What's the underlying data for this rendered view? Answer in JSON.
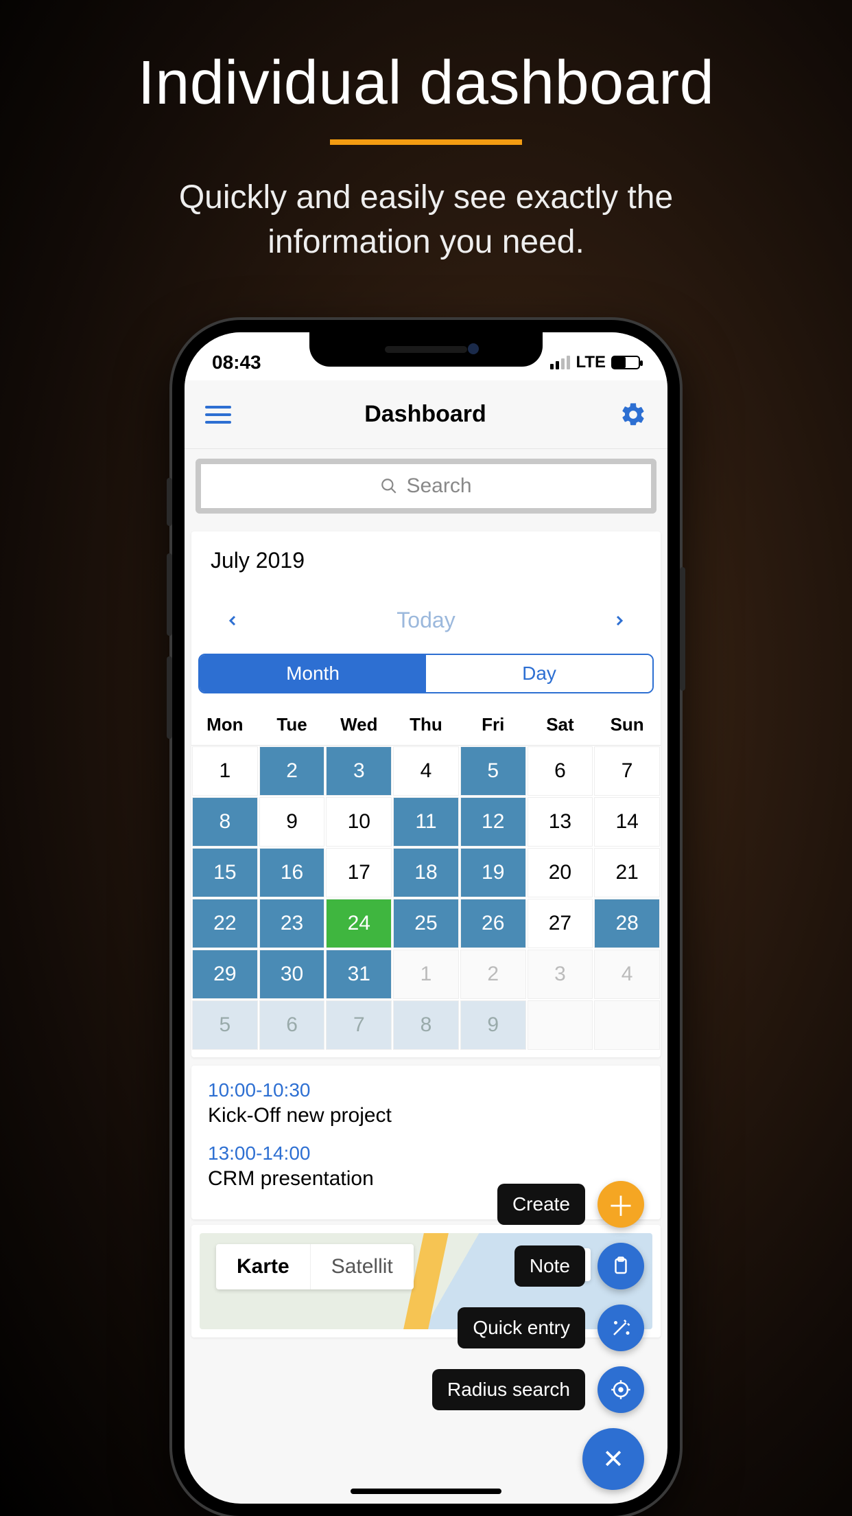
{
  "promo": {
    "title": "Individual dashboard",
    "subtitle_line1": "Quickly and easily see exactly the",
    "subtitle_line2": "information you need."
  },
  "status": {
    "time": "08:43",
    "carrier": "LTE"
  },
  "nav": {
    "title": "Dashboard"
  },
  "search": {
    "placeholder": "Search"
  },
  "calendar": {
    "month_label": "July 2019",
    "today_label": "Today",
    "tabs": {
      "month": "Month",
      "day": "Day"
    },
    "weekdays": [
      "Mon",
      "Tue",
      "Wed",
      "Thu",
      "Fri",
      "Sat",
      "Sun"
    ],
    "rows": [
      [
        {
          "d": "1",
          "s": "plain"
        },
        {
          "d": "2",
          "s": "mark"
        },
        {
          "d": "3",
          "s": "mark"
        },
        {
          "d": "4",
          "s": "plain"
        },
        {
          "d": "5",
          "s": "mark"
        },
        {
          "d": "6",
          "s": "plain"
        },
        {
          "d": "7",
          "s": "plain"
        }
      ],
      [
        {
          "d": "8",
          "s": "mark"
        },
        {
          "d": "9",
          "s": "plain"
        },
        {
          "d": "10",
          "s": "plain"
        },
        {
          "d": "11",
          "s": "mark"
        },
        {
          "d": "12",
          "s": "mark"
        },
        {
          "d": "13",
          "s": "plain"
        },
        {
          "d": "14",
          "s": "plain"
        }
      ],
      [
        {
          "d": "15",
          "s": "mark"
        },
        {
          "d": "16",
          "s": "mark"
        },
        {
          "d": "17",
          "s": "plain"
        },
        {
          "d": "18",
          "s": "mark"
        },
        {
          "d": "19",
          "s": "mark"
        },
        {
          "d": "20",
          "s": "plain"
        },
        {
          "d": "21",
          "s": "plain"
        }
      ],
      [
        {
          "d": "22",
          "s": "mark"
        },
        {
          "d": "23",
          "s": "mark"
        },
        {
          "d": "24",
          "s": "today"
        },
        {
          "d": "25",
          "s": "mark"
        },
        {
          "d": "26",
          "s": "mark"
        },
        {
          "d": "27",
          "s": "plain"
        },
        {
          "d": "28",
          "s": "mark"
        }
      ],
      [
        {
          "d": "29",
          "s": "mark"
        },
        {
          "d": "30",
          "s": "mark"
        },
        {
          "d": "31",
          "s": "mark"
        },
        {
          "d": "1",
          "s": "out"
        },
        {
          "d": "2",
          "s": "out"
        },
        {
          "d": "3",
          "s": "out"
        },
        {
          "d": "4",
          "s": "out"
        }
      ],
      [
        {
          "d": "5",
          "s": "outmark"
        },
        {
          "d": "6",
          "s": "outmark"
        },
        {
          "d": "7",
          "s": "outmark"
        },
        {
          "d": "8",
          "s": "outmark"
        },
        {
          "d": "9",
          "s": "outmark"
        },
        {
          "d": "",
          "s": "out"
        },
        {
          "d": "",
          "s": "out"
        }
      ]
    ]
  },
  "events": [
    {
      "time": "10:00-10:30",
      "title": "Kick-Off new project"
    },
    {
      "time": "13:00-14:00",
      "title": "CRM presentation"
    }
  ],
  "map": {
    "tab_map": "Karte",
    "tab_sat": "Satellit"
  },
  "fab": {
    "create": "Create",
    "note": "Note",
    "quick": "Quick entry",
    "radius": "Radius search"
  }
}
